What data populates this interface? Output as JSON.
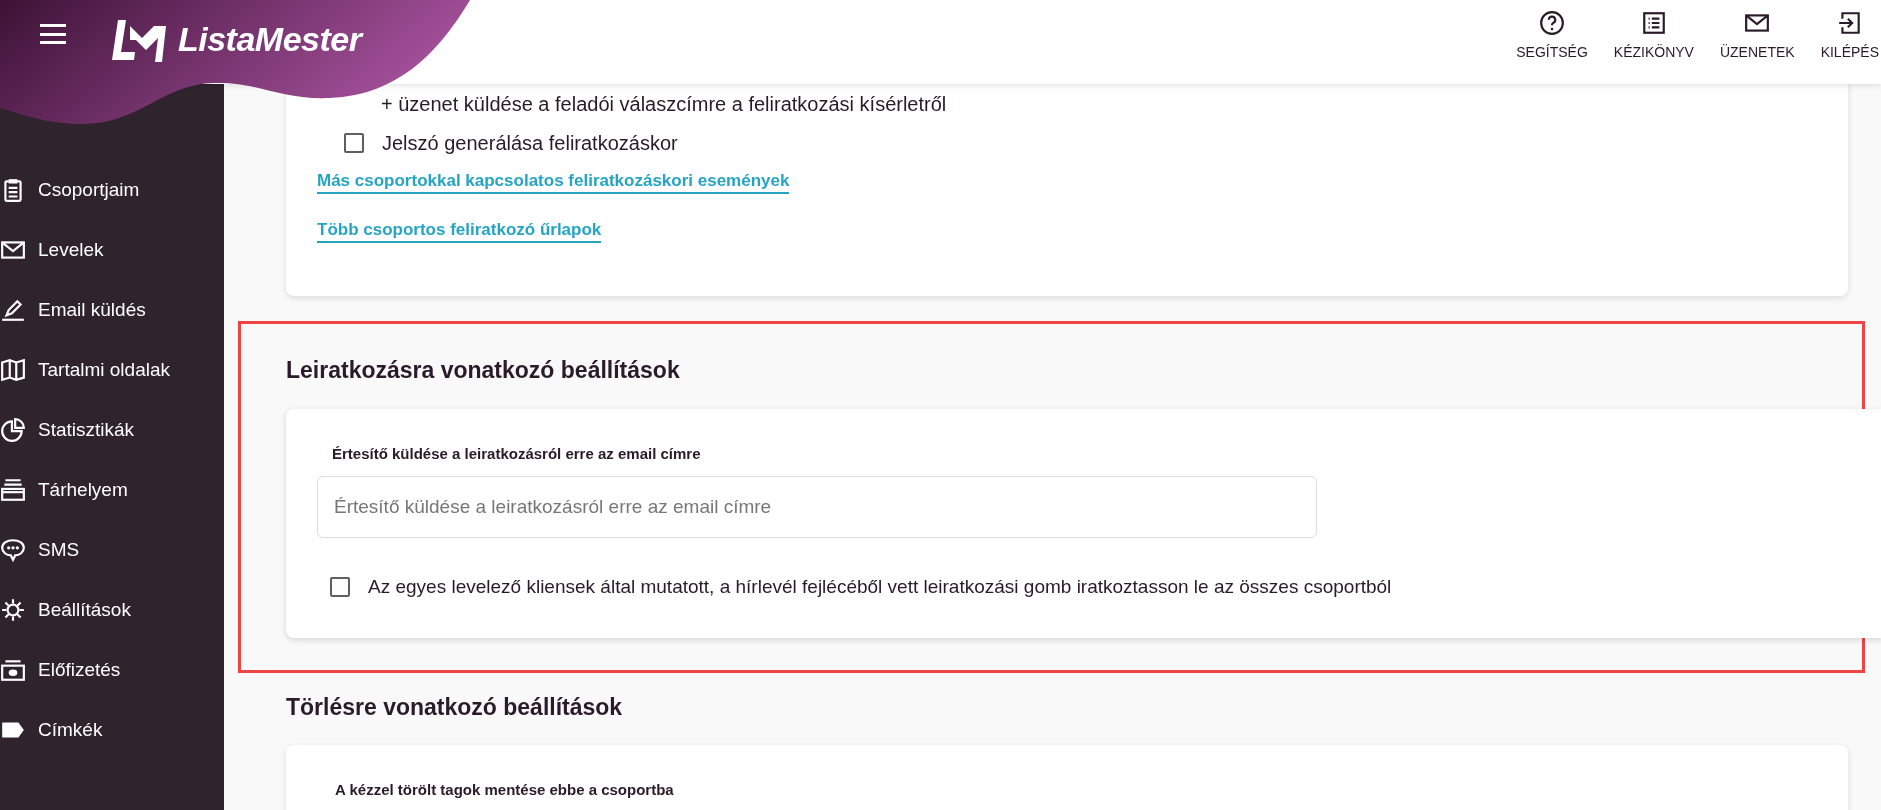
{
  "header": {
    "brand": "ListaMester",
    "actions": [
      {
        "kind": "help",
        "label": "SEGÍTSÉG"
      },
      {
        "kind": "manual",
        "label": "KÉZIKÖNYV"
      },
      {
        "kind": "messages",
        "label": "ÜZENETEK"
      },
      {
        "kind": "logout",
        "label": "KILÉPÉS"
      }
    ]
  },
  "sidebar": {
    "items": [
      {
        "kind": "groups",
        "label": "Csoportjaim"
      },
      {
        "kind": "letters",
        "label": "Levelek"
      },
      {
        "kind": "send",
        "label": "Email küldés"
      },
      {
        "kind": "pages",
        "label": "Tartalmi oldalak"
      },
      {
        "kind": "stats",
        "label": "Statisztikák"
      },
      {
        "kind": "storage",
        "label": "Tárhelyem"
      },
      {
        "kind": "sms",
        "label": "SMS"
      },
      {
        "kind": "settings",
        "label": "Beállítások"
      },
      {
        "kind": "subscription",
        "label": "Előfizetés"
      },
      {
        "kind": "tags",
        "label": "Címkék"
      }
    ]
  },
  "subscribe_card": {
    "note": "+ üzenet küldése a feladói válaszcímre a feliratkozási kísérletről",
    "options": [
      {
        "label": "Jelszó generálása feliratkozáskor",
        "checked": false
      }
    ],
    "links": [
      "Más csoportokkal kapcsolatos feliratkozáskori események",
      "Több csoportos feliratkozó űrlapok"
    ]
  },
  "unsubscribe_section": {
    "title": "Leiratkozásra vonatkozó beállítások",
    "highlighted": true,
    "field": {
      "label": "Értesítő küldése a leiratkozásról erre az email címre",
      "placeholder": "Értesítő küldése a leiratkozásról erre az email címre"
    },
    "options": [
      {
        "label": "Az egyes levelező kliensek által mutatott, a hírlevél fejlécéből vett leiratkozási gomb iratkoztasson le az összes csoportból",
        "checked": false
      }
    ]
  },
  "delete_section": {
    "title": "Törlésre vonatkozó beállítások",
    "field_label": "A kézzel törölt tagok mentése ebbe a csoportba"
  }
}
